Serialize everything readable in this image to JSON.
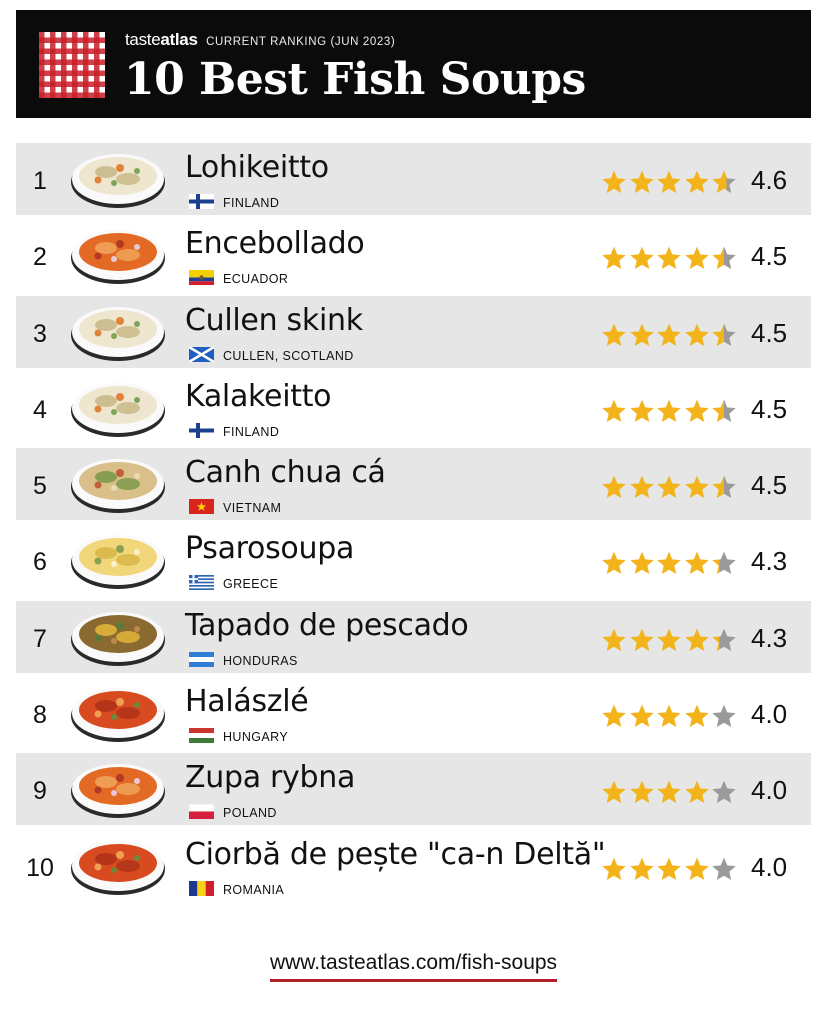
{
  "header": {
    "brand_regular": "taste",
    "brand_bold": "atlas",
    "ranking_label": "CURRENT RANKING (JUN 2023)",
    "title": "10 Best Fish Soups"
  },
  "colors": {
    "star_filled": "#f2b31b",
    "star_empty": "#9a9a9a",
    "accent": "#b0202a"
  },
  "items": [
    {
      "rank": "1",
      "name": "Lohikeitto",
      "country": "FINLAND",
      "flag": "finland",
      "rating": "4.6",
      "stars": 4.6,
      "bowl": "cream"
    },
    {
      "rank": "2",
      "name": "Encebollado",
      "country": "ECUADOR",
      "flag": "ecuador",
      "rating": "4.5",
      "stars": 4.5,
      "bowl": "orange"
    },
    {
      "rank": "3",
      "name": "Cullen skink",
      "country": "CULLEN, SCOTLAND",
      "flag": "scotland",
      "rating": "4.5",
      "stars": 4.5,
      "bowl": "cream"
    },
    {
      "rank": "4",
      "name": "Kalakeitto",
      "country": "FINLAND",
      "flag": "finland",
      "rating": "4.5",
      "stars": 4.5,
      "bowl": "cream"
    },
    {
      "rank": "5",
      "name": "Canh chua cá",
      "country": "VIETNAM",
      "flag": "vietnam",
      "rating": "4.5",
      "stars": 4.5,
      "bowl": "greens"
    },
    {
      "rank": "6",
      "name": "Psarosoupa",
      "country": "GREECE",
      "flag": "greece",
      "rating": "4.3",
      "stars": 4.3,
      "bowl": "yellow"
    },
    {
      "rank": "7",
      "name": "Tapado de pescado",
      "country": "HONDURAS",
      "flag": "honduras",
      "rating": "4.3",
      "stars": 4.3,
      "bowl": "brown"
    },
    {
      "rank": "8",
      "name": "Halászlé",
      "country": "HUNGARY",
      "flag": "hungary",
      "rating": "4.0",
      "stars": 4.0,
      "bowl": "red"
    },
    {
      "rank": "9",
      "name": "Zupa rybna",
      "country": "POLAND",
      "flag": "poland",
      "rating": "4.0",
      "stars": 4.0,
      "bowl": "orange"
    },
    {
      "rank": "10",
      "name": "Ciorbă de pește \"ca-n Deltă\"",
      "country": "ROMANIA",
      "flag": "romania",
      "rating": "4.0",
      "stars": 4.0,
      "bowl": "red"
    }
  ],
  "footer": {
    "url": "www.tasteatlas.com/fish-soups"
  }
}
